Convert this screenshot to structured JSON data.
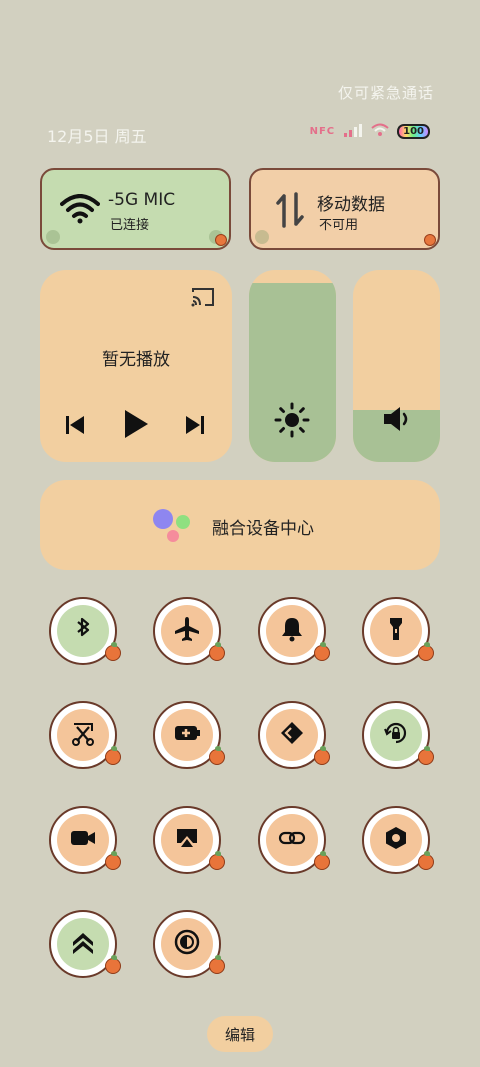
{
  "header": {
    "emergency_text": "仅可紧急通话",
    "date": "12月5日 周五",
    "nfc_label": "NFC",
    "battery": "100"
  },
  "wifi": {
    "title": "-5G      MIC",
    "status": "已连接",
    "icon": "wifi-icon"
  },
  "mobile_data": {
    "title": "移动数据",
    "status": "不可用",
    "icon": "data-arrows-icon"
  },
  "media": {
    "title": "暂无播放",
    "cast_icon": "cast-icon",
    "prev_icon": "skip-previous-icon",
    "play_icon": "play-icon",
    "next_icon": "skip-next-icon"
  },
  "brightness": {
    "icon": "sun-icon",
    "level": 0.93
  },
  "volume": {
    "icon": "speaker-icon",
    "level": 0.27
  },
  "fusion": {
    "label": "融合设备中心"
  },
  "toggles": [
    {
      "name": "bluetooth",
      "icon": "bluetooth-icon",
      "active": true
    },
    {
      "name": "airplane",
      "icon": "airplane-icon",
      "active": false
    },
    {
      "name": "bell",
      "icon": "bell-icon",
      "active": false
    },
    {
      "name": "flashlight",
      "icon": "flashlight-icon",
      "active": false
    },
    {
      "name": "screenshot",
      "icon": "scissors-icon",
      "active": false
    },
    {
      "name": "battery-saver",
      "icon": "battery-plus-icon",
      "active": false
    },
    {
      "name": "nearby-share",
      "icon": "diamond-arrow-icon",
      "active": false
    },
    {
      "name": "rotation-lock",
      "icon": "rotation-lock-icon",
      "active": true
    },
    {
      "name": "screen-record",
      "icon": "video-camera-icon",
      "active": false
    },
    {
      "name": "screen-cast",
      "icon": "airplay-icon",
      "active": false
    },
    {
      "name": "link",
      "icon": "link-icon",
      "active": false
    },
    {
      "name": "settings-hex",
      "icon": "hexagon-nut-icon",
      "active": false
    },
    {
      "name": "performance",
      "icon": "chevrons-up-icon",
      "active": true
    },
    {
      "name": "dark-mode",
      "icon": "contrast-icon",
      "active": false
    }
  ],
  "footer": {
    "edit_label": "编辑"
  },
  "colors": {
    "background": "#d2d0c0",
    "tile_orange": "#f2cfa0",
    "tile_green": "#c5dcb0",
    "slider_fill": "#a8c195",
    "outline_brown": "#6a3a2a"
  }
}
